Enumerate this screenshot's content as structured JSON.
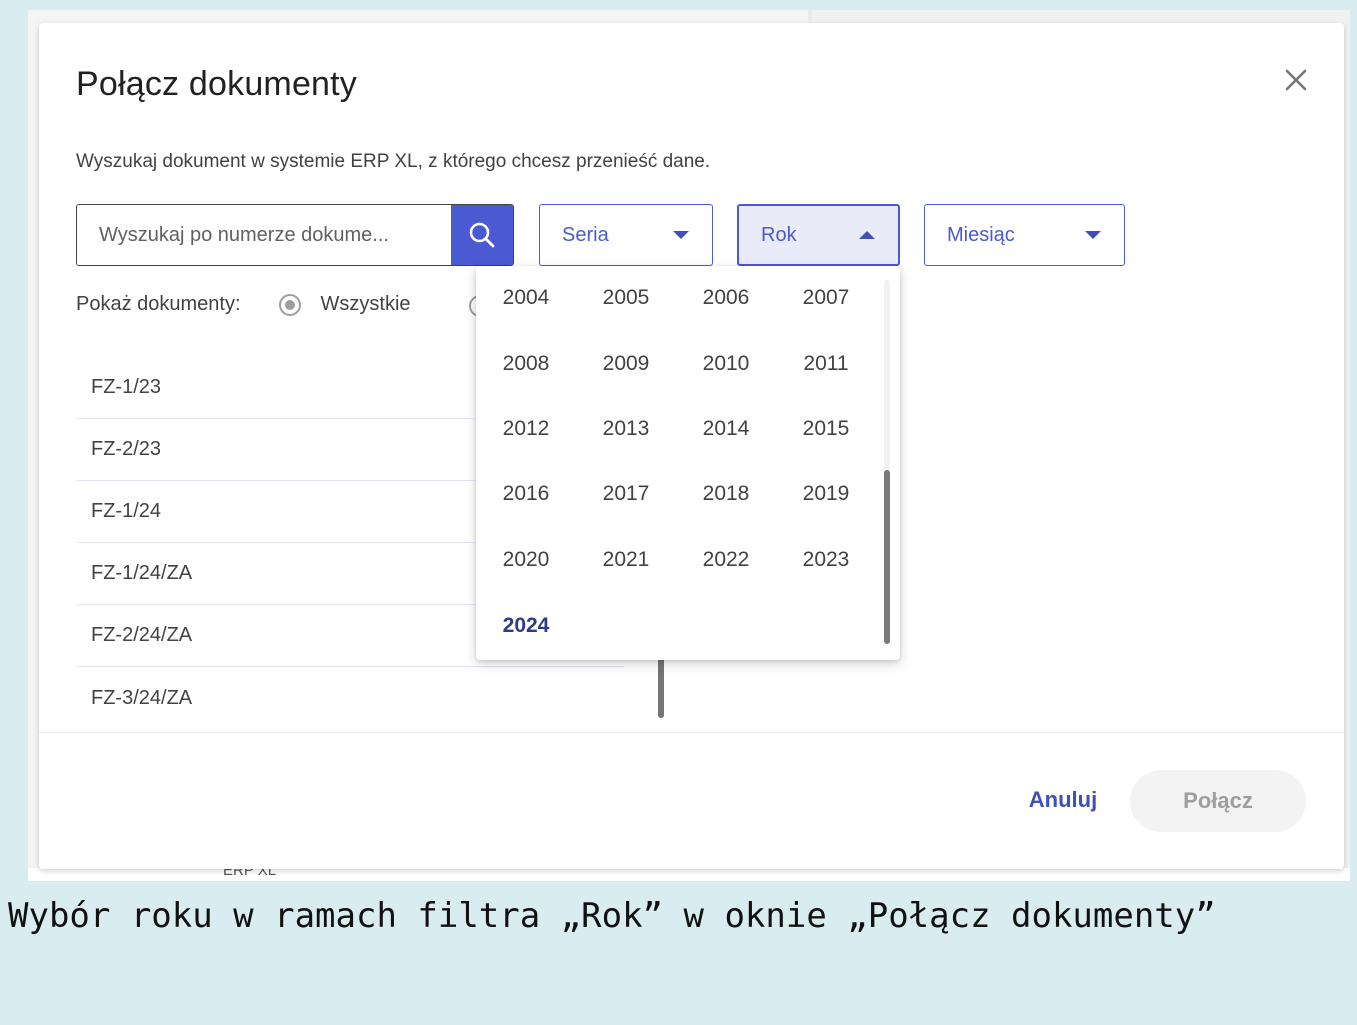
{
  "background": {
    "fragments": [
      "ERP XL"
    ]
  },
  "dialog": {
    "title": "Połącz dokumenty",
    "subtitle": "Wyszukaj dokument w systemie ERP XL, z którego chcesz przenieść dane.",
    "search": {
      "placeholder": "Wyszukaj po numerze dokume..."
    },
    "filters": {
      "seria": "Seria",
      "rok": "Rok",
      "miesiac": "Miesiąc"
    },
    "show_documents": {
      "label": "Pokaż dokumenty:",
      "option_all": "Wszystkie"
    },
    "documents": [
      "FZ-1/23",
      "FZ-2/23",
      "FZ-1/24",
      "FZ-1/24/ZA",
      "FZ-2/24/ZA",
      "FZ-3/24/ZA"
    ],
    "buttons": {
      "cancel": "Anuluj",
      "connect": "Połącz"
    }
  },
  "year_dropdown": {
    "years": [
      "2004",
      "2005",
      "2006",
      "2007",
      "2008",
      "2009",
      "2010",
      "2011",
      "2012",
      "2013",
      "2014",
      "2015",
      "2016",
      "2017",
      "2018",
      "2019",
      "2020",
      "2021",
      "2022",
      "2023",
      "2024"
    ],
    "selected": "2024"
  },
  "caption": "Wybór roku w ramach filtra „Rok” w oknie „Połącz dokumenty”",
  "colors": {
    "accent": "#4a5ad2",
    "page_background": "#d9ecf0"
  }
}
